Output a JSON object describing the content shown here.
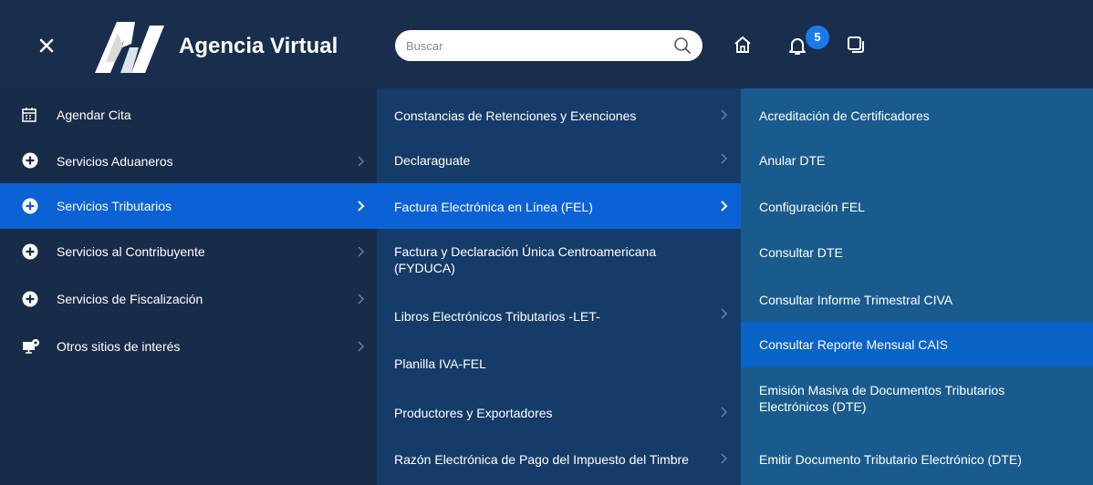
{
  "header": {
    "brand": "Agencia Virtual",
    "search_placeholder": "Buscar",
    "notification_count": "5"
  },
  "menu": {
    "level1": [
      {
        "label": "Agendar Cita",
        "icon": "calendar-icon"
      },
      {
        "label": "Servicios Aduaneros",
        "icon": "plus-circle-icon"
      },
      {
        "label": "Servicios Tributarios",
        "icon": "plus-circle-icon",
        "selected": true
      },
      {
        "label": "Servicios al Contribuyente",
        "icon": "plus-circle-icon"
      },
      {
        "label": "Servicios de Fiscalización",
        "icon": "plus-circle-icon"
      },
      {
        "label": "Otros sitios de interés",
        "icon": "monitor-gear-icon"
      }
    ],
    "level2": [
      {
        "label": "Constancias de Retenciones y Exenciones"
      },
      {
        "label": "Declaraguate"
      },
      {
        "label": "Factura Electrónica en Línea (FEL)",
        "selected": true
      },
      {
        "label": "Factura y Declaración Única Centroamericana (FYDUCA)"
      },
      {
        "label": "Libros Electrónicos Tributarios -LET-"
      },
      {
        "label": "Planilla IVA-FEL"
      },
      {
        "label": "Productores y Exportadores"
      },
      {
        "label": "Razón Electrónica de Pago del Impuesto del Timbre"
      }
    ],
    "level3": [
      {
        "label": "Acreditación de Certificadores"
      },
      {
        "label": "Anular DTE"
      },
      {
        "label": "Configuración FEL"
      },
      {
        "label": "Consultar DTE"
      },
      {
        "label": "Consultar Informe Trimestral CIVA"
      },
      {
        "label": "Consultar Reporte Mensual CAIS",
        "selected": true
      },
      {
        "label": "Emisión Masiva de Documentos Tributarios Electrónicos (DTE)"
      },
      {
        "label": "Emitir Documento Tributario Electrónico (DTE)"
      }
    ]
  },
  "colors": {
    "header_bg": "#192e4d",
    "col1_bg": "#182c4a",
    "col2_bg": "#153c68",
    "col3_bg": "#1a5b8d",
    "selected_bg": "#0b62d4"
  }
}
